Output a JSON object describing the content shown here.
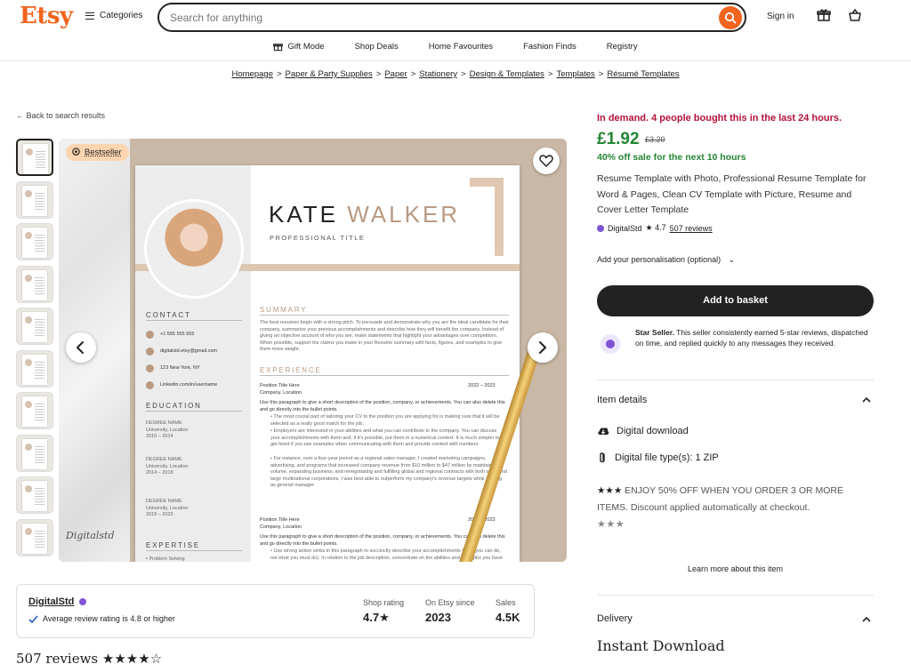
{
  "header": {
    "logo": "Etsy",
    "categories_label": "Categories",
    "search_placeholder": "Search for anything",
    "signin_label": "Sign in"
  },
  "subnav": [
    "Gift Mode",
    "Shop Deals",
    "Home Favourites",
    "Fashion Finds",
    "Registry"
  ],
  "breadcrumb": [
    "Homepage",
    "Paper & Party Supplies",
    "Paper",
    "Stationery",
    "Design & Templates",
    "Templates",
    "Résumé Templates"
  ],
  "back_label": "Back to search results",
  "image": {
    "badge": "Bestseller",
    "resume": {
      "first_name": "KATE",
      "last_name": "WALKER",
      "title": "PROFESSIONAL TITLE",
      "summary_h": "SUMMARY",
      "summary_text": "The best resumes begin with a strong pitch. To persuade and demonstrate why you are the ideal candidate for their company, summarize your previous accomplishments and describe how they will benefit the company. Instead of giving an objective account of who you are, make statements that highlight your advantages over competitors. When possible, support the claims you make in your Resume summary with facts, figures, and examples to give them more weight.",
      "experience_h": "EXPERIENCE",
      "job1_title": "Position Title Here",
      "job1_dates": "2022 – 2023",
      "job1_company": "Company, Location",
      "job1_desc": "Use this paragraph to give a short description of the position, company, or achievements. You can also delete this and go directly into the bullet points.",
      "job1_bullets": [
        "The most crucial part of tailoring your CV to the position you are applying for is making sure that it will be selected as a really good match for the job.",
        "Employers are interested in your abilities and what you can contribute to the company. You can discuss your accomplishments with them and, if it's possible, put them in a numerical context. It is much simpler to get hired if you use examples when communicating with them and provide context with numbers",
        "For instance, over a four-year period as a regional sales manager, I created marketing campaigns, advertising, and programs that increased company revenue from $10 million to $47 million by maintaining volume, expanding business, and renegotiating and fulfilling global and regional contracts with both small and large multinational corporations, I was best able to outperform my company's revenue targets while serving as general manager."
      ],
      "job2_title": "Position Title Here",
      "job2_dates": "2022 – 2023",
      "job2_company": "Company, Location",
      "job2_desc": "Use this paragraph to give a short description of the position, company, or achievements. You can also delete this and go directly into the bullet points.",
      "job2_bullet": "Use strong action verbs in this paragraph to succinctly describe your accomplishments (what you can do, not what you must do). In relation to the job description, concentrate on the abilities and strengths you have identified. Writing unimportant things on your resume will distance you from your competitors.",
      "contact_h": "CONTACT",
      "contacts": [
        "+1 555 555 555",
        "digitalstd.etsy@gmail.com",
        "123 New York, NY",
        "Linkedin.com/in/username"
      ],
      "education_h": "EDUCATION",
      "edu": [
        {
          "deg": "DEGREE NAME",
          "loc": "University, Location",
          "yrs": "2010 – 2014"
        },
        {
          "deg": "DEGREE NAME",
          "loc": "University, Location",
          "yrs": "2014 – 2018"
        },
        {
          "deg": "DEGREE NAME",
          "loc": "University, Location",
          "yrs": "2018 – 2023"
        }
      ],
      "expertise_h": "EXPERTISE",
      "expertise_first": "Problem Solving"
    },
    "signature": "Digitalstd"
  },
  "product": {
    "demand": "In demand. 4 people bought this in the last 24 hours.",
    "price": "£1.92",
    "old_price": "£3.20",
    "sale": "40% off sale for the next 10 hours",
    "title": "Resume Template with Photo, Professional Resume Template for Word & Pages, Clean CV Template with Picture, Resume and Cover Letter Template",
    "seller": "DigitalStd",
    "rating": "★ 4.7",
    "reviews_link": "507 reviews",
    "personalisation": "Add your personalisation (optional)",
    "add_to_basket": "Add to basket",
    "star_seller_bold": "Star Seller.",
    "star_seller_text": " This seller consistently earned 5-star reviews, dispatched on time, and replied quickly to any messages they received.",
    "item_details": "Item details",
    "feature_download": "Digital download",
    "feature_files": "Digital file type(s): 1 ZIP",
    "promo_stars": "★★★",
    "promo_text": " ENJOY 50% OFF WHEN YOU ORDER 3 OR MORE ITEMS. Discount applied automatically at checkout.",
    "promo_grey_stars": "★★★",
    "learn_more": "Learn more about this item",
    "delivery": "Delivery",
    "instant": "Instant Download"
  },
  "shop": {
    "name": "DigitalStd",
    "avg": "Average review rating is 4.8 or higher",
    "shop_rating_label": "Shop rating",
    "shop_rating": "4.7★",
    "since_label": "On Etsy since",
    "since": "2023",
    "sales_label": "Sales",
    "sales": "4.5K"
  },
  "reviews_heading": "507 reviews ★★★★☆",
  "colors": {
    "brand": "#f1641e",
    "price_green": "#258635",
    "demand_red": "#b3123a",
    "star_seller_purple": "#7f54d4"
  }
}
